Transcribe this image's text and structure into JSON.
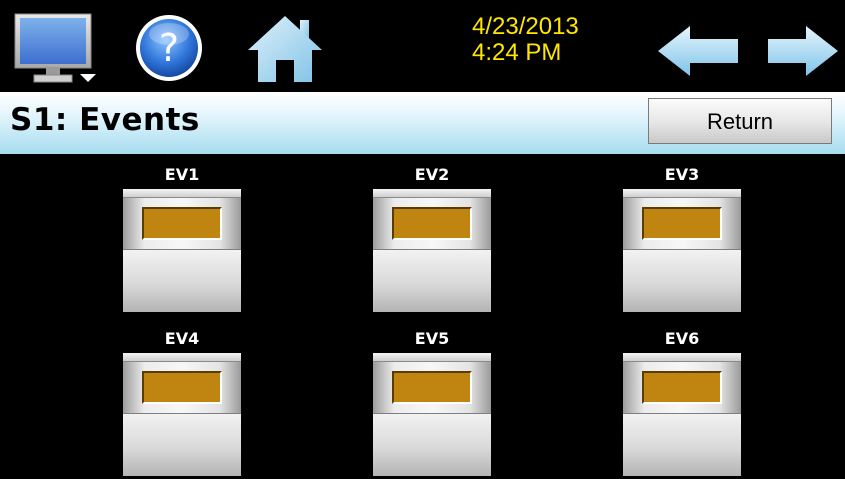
{
  "topbar": {
    "icons": {
      "monitor": "monitor-menu-icon",
      "help": "help-icon",
      "home": "home-icon",
      "back": "back-arrow-icon",
      "forward": "forward-arrow-icon"
    },
    "date": "4/23/2013",
    "time": "4:24 PM",
    "datetime_color": "#ffe600"
  },
  "header": {
    "title": "S1: Events",
    "return_label": "Return"
  },
  "events": [
    {
      "label": "EV1"
    },
    {
      "label": "EV2"
    },
    {
      "label": "EV3"
    },
    {
      "label": "EV4"
    },
    {
      "label": "EV5"
    },
    {
      "label": "EV6"
    }
  ],
  "colors": {
    "indicator": "#c08510",
    "header_gradient_bottom": "#a6dcef"
  }
}
